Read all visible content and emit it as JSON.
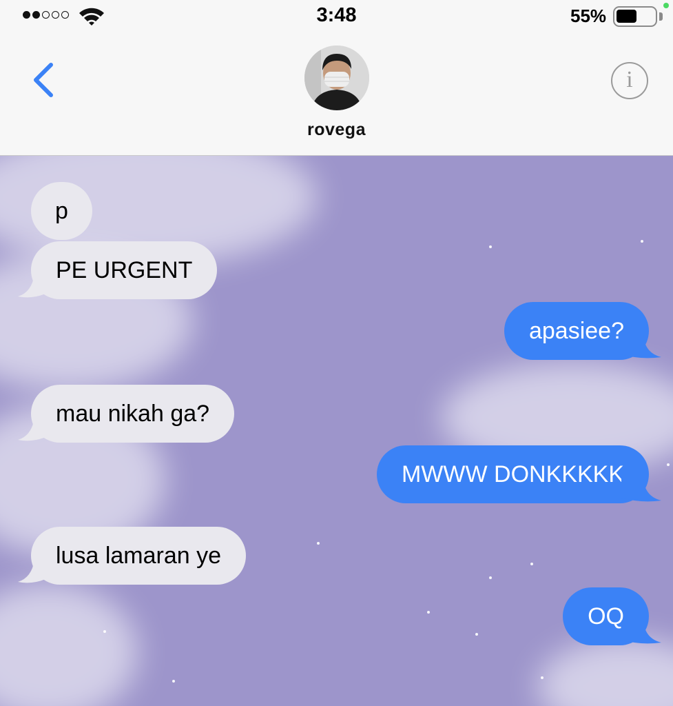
{
  "status_bar": {
    "signal_dots": [
      true,
      true,
      false,
      false,
      false
    ],
    "time": "3:48",
    "battery_percent": "55%",
    "battery_level": 0.55
  },
  "header": {
    "contact_name": "rovega",
    "info_icon": "info-icon",
    "back_icon": "chevron-left-icon"
  },
  "colors": {
    "accent": "#3b82f6",
    "incoming_bubble": "#e9e8ee",
    "chat_background": "#9d95cb"
  },
  "messages": [
    {
      "direction": "incoming",
      "text": "p"
    },
    {
      "direction": "incoming",
      "text": "PE URGENT"
    },
    {
      "direction": "outgoing",
      "text": "apasiee?"
    },
    {
      "direction": "incoming",
      "text": "mau nikah ga?"
    },
    {
      "direction": "outgoing",
      "text": "MWWW DONKKKKK"
    },
    {
      "direction": "incoming",
      "text": "lusa lamaran ye"
    },
    {
      "direction": "outgoing",
      "text": "OQ"
    }
  ]
}
